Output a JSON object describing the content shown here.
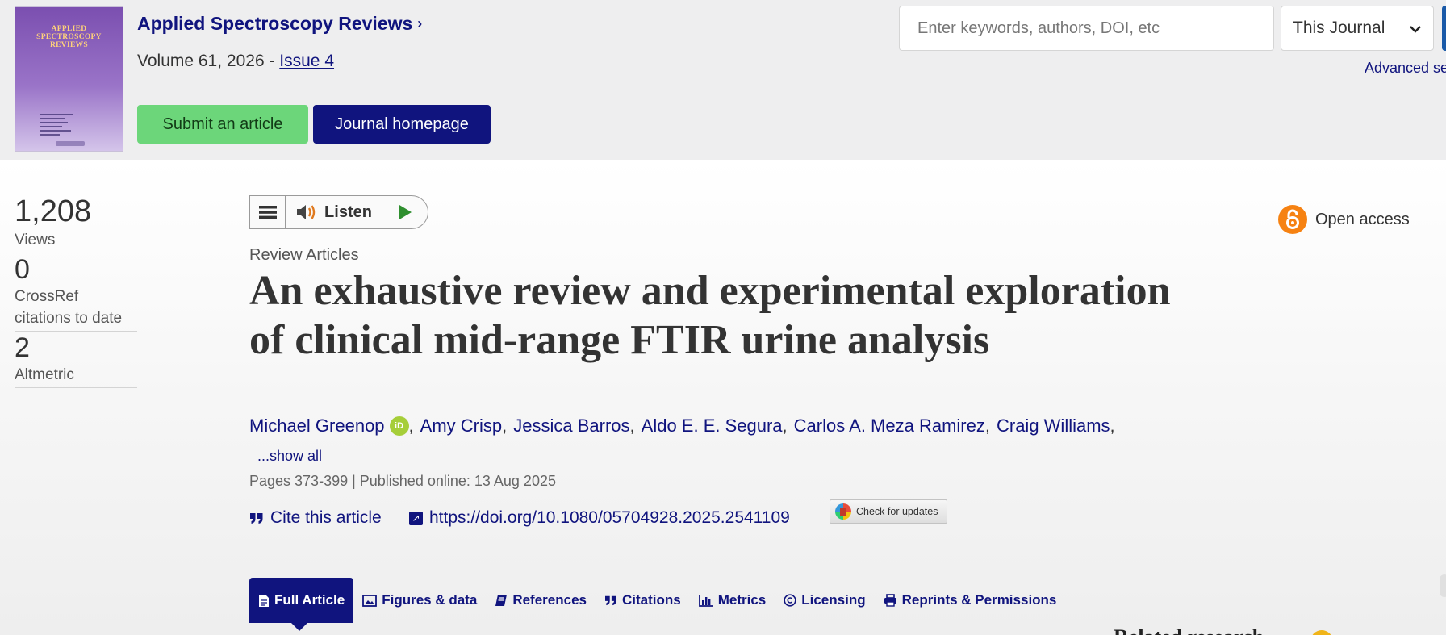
{
  "header": {
    "journal_title": "Applied Spectroscopy Reviews",
    "volume_prefix": "Volume 61, 2026 - ",
    "issue_link": "Issue 4",
    "submit_button": "Submit an article",
    "homepage_button": "Journal homepage",
    "cover": {
      "title_line1": "APPLIED",
      "title_line2": "SPECTROSCOPY",
      "title_line3": "REVIEWS"
    }
  },
  "search": {
    "placeholder": "Enter keywords, authors, DOI, etc",
    "scope": "This Journal",
    "advanced_label": "Advanced se"
  },
  "metrics": {
    "views_value": "1,208",
    "views_label": "Views",
    "crossref_value": "0",
    "crossref_label": "CrossRef citations to date",
    "altmetric_value": "2",
    "altmetric_label": "Altmetric"
  },
  "listen": {
    "label": "Listen"
  },
  "article": {
    "type": "Review Articles",
    "title": "An exhaustive review and experimental exploration of clinical mid-range FTIR urine analysis",
    "authors": [
      "Michael Greenop",
      "Amy Crisp",
      "Jessica Barros",
      "Aldo E. E. Segura",
      "Carlos A. Meza Ramirez",
      "Craig Williams"
    ],
    "show_all": "...show all",
    "pub_info": "Pages 373-399 | Published online: 13 Aug 2025",
    "cite_label": "Cite this article",
    "doi": "https://doi.org/10.1080/05704928.2025.2541109",
    "check_updates": "Check for updates",
    "open_access": "Open access"
  },
  "tabs": [
    {
      "label": "Full Article",
      "icon": "document-icon"
    },
    {
      "label": "Figures & data",
      "icon": "image-icon"
    },
    {
      "label": "References",
      "icon": "book-icon"
    },
    {
      "label": "Citations",
      "icon": "quote-icon"
    },
    {
      "label": "Metrics",
      "icon": "bar-chart-icon"
    },
    {
      "label": "Licensing",
      "icon": "copyright-icon"
    },
    {
      "label": "Reprints & Permissions",
      "icon": "print-icon"
    }
  ],
  "related_peek": "Related research",
  "colors": {
    "brand_navy": "#10147e",
    "submit_green": "#6cd67a",
    "open_access_orange": "#f68212"
  }
}
